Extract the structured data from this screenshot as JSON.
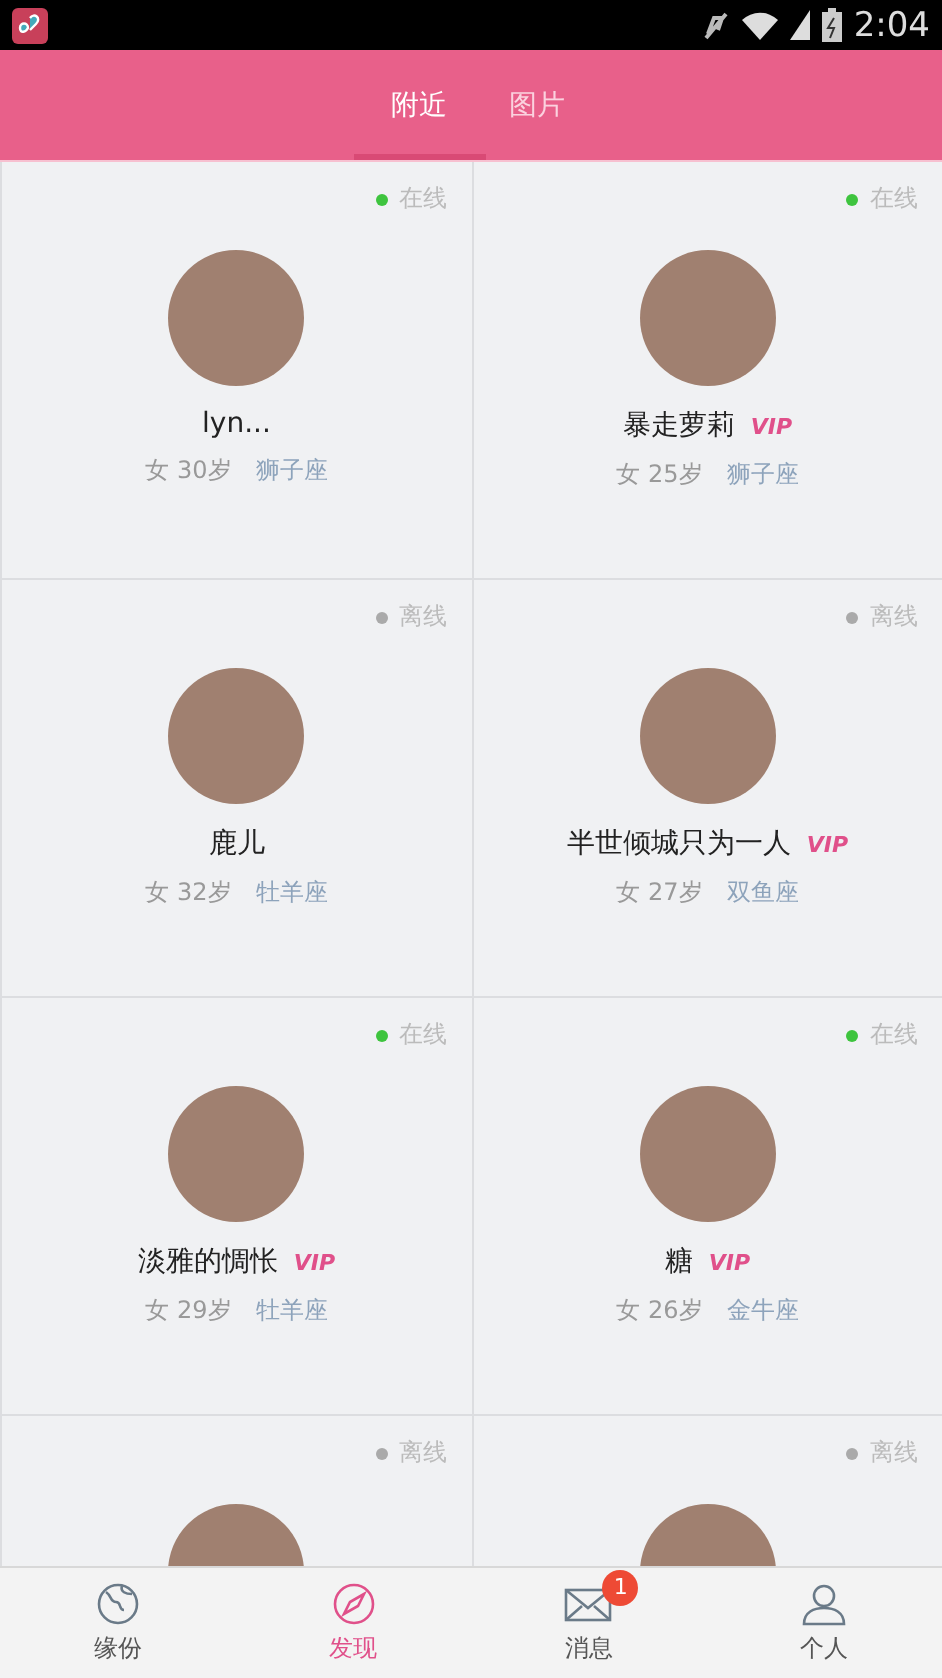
{
  "status_bar": {
    "time": "2:04"
  },
  "tabs": [
    {
      "label": "附近",
      "selected": true
    },
    {
      "label": "图片",
      "selected": false
    }
  ],
  "users": [
    {
      "online": true,
      "status": "在线",
      "name": "lyn...",
      "gender": "女",
      "age": "30岁",
      "zodiac": "狮子座"
    },
    {
      "online": true,
      "status": "在线",
      "name": "暴走萝莉",
      "vip": "VIP",
      "gender": "女",
      "age": "25岁",
      "zodiac": "狮子座"
    },
    {
      "online": false,
      "status": "离线",
      "name": "鹿儿",
      "gender": "女",
      "age": "32岁",
      "zodiac": "牡羊座"
    },
    {
      "online": false,
      "status": "离线",
      "name": "半世倾城只为一人",
      "vip": "VIP",
      "gender": "女",
      "age": "27岁",
      "zodiac": "双鱼座"
    },
    {
      "online": true,
      "status": "在线",
      "name": "淡雅的惆怅",
      "vip": "VIP",
      "gender": "女",
      "age": "29岁",
      "zodiac": "牡羊座"
    },
    {
      "online": true,
      "status": "在线",
      "name": "糖",
      "vip": "VIP",
      "gender": "女",
      "age": "26岁",
      "zodiac": "金牛座"
    },
    {
      "online": false,
      "status": "离线"
    },
    {
      "online": false,
      "status": "离线"
    }
  ],
  "bottom_nav": [
    {
      "kind": "globe",
      "label": "缘份",
      "selected": false
    },
    {
      "kind": "compass",
      "label": "发现",
      "selected": true
    },
    {
      "kind": "mail",
      "label": "消息",
      "selected": false,
      "badge": "1"
    },
    {
      "kind": "person",
      "label": "个人",
      "selected": false
    }
  ]
}
